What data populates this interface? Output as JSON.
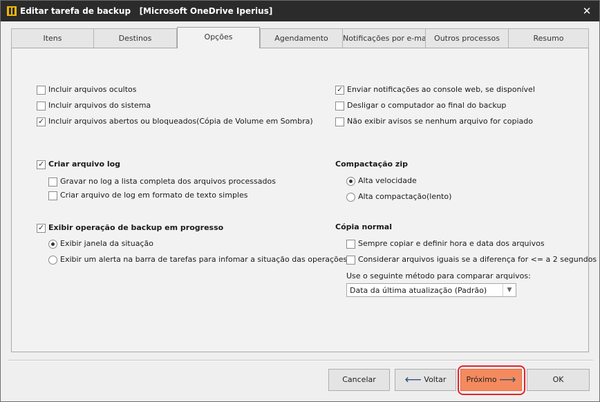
{
  "window": {
    "title": "Editar tarefa de backup   [Microsoft OneDrive Iperius]",
    "close_glyph": "✕"
  },
  "tabs": [
    {
      "label": "Itens"
    },
    {
      "label": "Destinos"
    },
    {
      "label": "Opções"
    },
    {
      "label": "Agendamento"
    },
    {
      "label": "Notificações por e-mail"
    },
    {
      "label": "Outros processos"
    },
    {
      "label": "Resumo"
    }
  ],
  "active_tab": "Opções",
  "options": {
    "left": [
      {
        "label": "Incluir arquivos ocultos",
        "checked": false
      },
      {
        "label": "Incluir arquivos do sistema",
        "checked": false
      },
      {
        "label": "Incluir arquivos abertos ou bloqueados(Cópia de Volume em Sombra)",
        "checked": true
      }
    ],
    "right": [
      {
        "label": "Enviar notificações ao console web, se disponível",
        "checked": true
      },
      {
        "label": "Desligar o computador ao final do backup",
        "checked": false
      },
      {
        "label": "Não exibir avisos se nenhum arquivo for copiado",
        "checked": false
      }
    ]
  },
  "log": {
    "label": "Criar arquivo log",
    "checked": true,
    "items": [
      {
        "label": "Gravar no log a lista completa dos arquivos processados",
        "checked": false
      },
      {
        "label": "Criar arquivo de log em formato de texto simples",
        "checked": false
      }
    ]
  },
  "progress": {
    "label": "Exibir operação de backup em progresso",
    "checked": true,
    "items": [
      {
        "label": "Exibir janela da situação",
        "selected": true
      },
      {
        "label": "Exibir um alerta na barra de tarefas para infomar a situação das operações",
        "selected": false
      }
    ]
  },
  "zip": {
    "title": "Compactação zip",
    "items": [
      {
        "label": "Alta velocidade",
        "selected": true
      },
      {
        "label": "Alta compactação(lento)",
        "selected": false
      }
    ]
  },
  "copy": {
    "title": "Cópia normal",
    "items": [
      {
        "label": "Sempre copiar e definir hora e data dos arquivos",
        "checked": false
      },
      {
        "label": "Considerar arquivos iguais se a diferença for <= a 2 segundos",
        "checked": false
      }
    ],
    "method_label": "Use o seguinte método para comparar arquivos:",
    "method_value": "Data da última atualização (Padrão)"
  },
  "buttons": {
    "cancel": "Cancelar",
    "back": "Voltar",
    "next": "Próximo",
    "ok": "OK"
  },
  "colors": {
    "next_button": "#f58a5e",
    "highlight": "#e8202a",
    "titlebar": "#2b2b2b"
  }
}
